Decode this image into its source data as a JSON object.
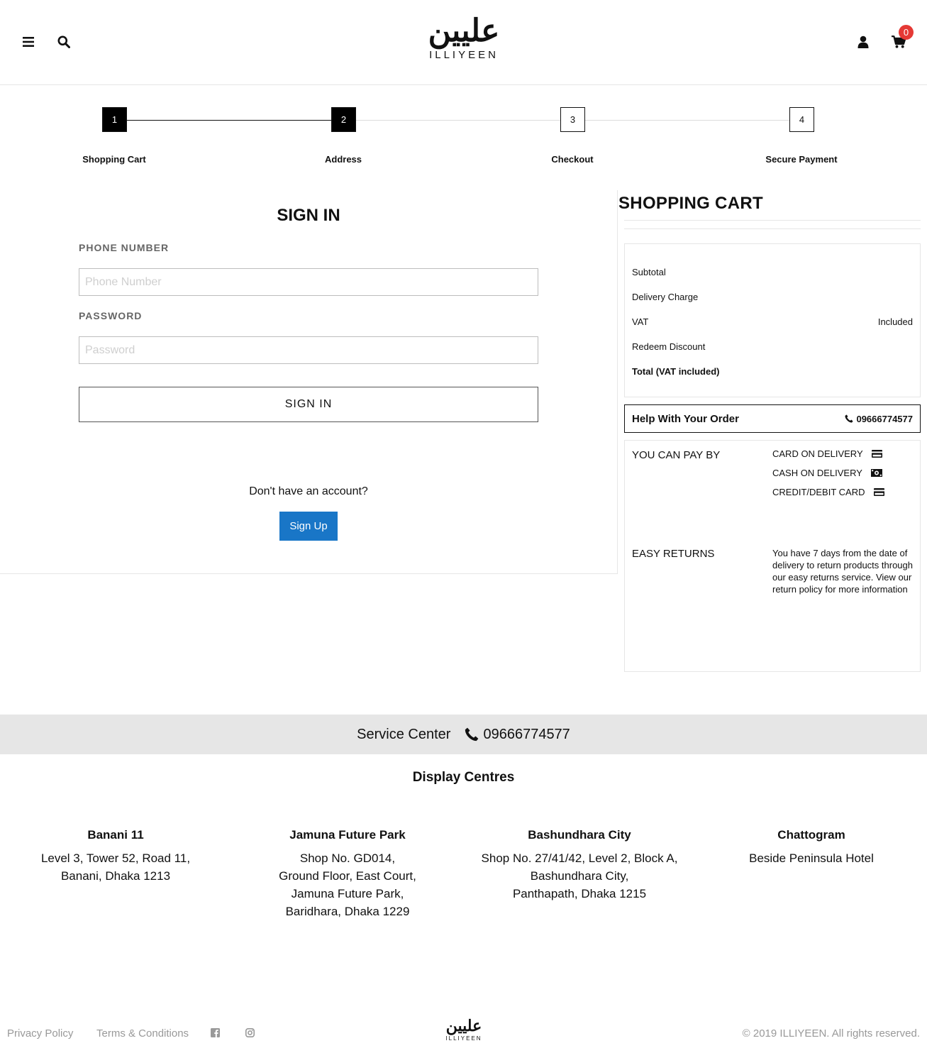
{
  "header": {
    "logo_arabic": "عليين",
    "logo_latin": "ILLIYEEN",
    "cart_count": "0"
  },
  "steps": [
    {
      "number": "1",
      "label": "Shopping Cart"
    },
    {
      "number": "2",
      "label": "Address"
    },
    {
      "number": "3",
      "label": "Checkout"
    },
    {
      "number": "4",
      "label": "Secure Payment"
    }
  ],
  "signin": {
    "title": "SIGN IN",
    "phone_label": "PHONE NUMBER",
    "phone_placeholder": "Phone Number",
    "phone_value": "",
    "password_label": "PASSWORD",
    "password_placeholder": "Password",
    "password_value": "",
    "button_label": "SIGN IN",
    "no_account_text": "Don't have an account?",
    "signup_label": "Sign Up"
  },
  "cart": {
    "title": "SHOPPING CART",
    "rows": [
      {
        "label": "Subtotal",
        "value": ""
      },
      {
        "label": "Delivery Charge",
        "value": ""
      },
      {
        "label": "VAT",
        "value": "Included"
      },
      {
        "label": "Redeem Discount",
        "value": ""
      },
      {
        "label": "Total (VAT included)",
        "value": ""
      }
    ],
    "help_title": "Help With Your Order",
    "help_phone": "09666774577",
    "pay_heading": "YOU CAN PAY BY",
    "pay_methods": [
      {
        "label": "CARD ON DELIVERY",
        "icon": "credit-card-icon"
      },
      {
        "label": "CASH ON DELIVERY",
        "icon": "cash-icon"
      },
      {
        "label": "CREDIT/DEBIT CARD",
        "icon": "credit-card-icon"
      }
    ],
    "returns_heading": "EASY RETURNS",
    "returns_text": "You have 7 days from the date of delivery to return products through our easy returns service. View our return policy for more information"
  },
  "service": {
    "label": "Service Center",
    "phone": "09666774577"
  },
  "display_centres": {
    "title": "Display Centres",
    "centres": [
      {
        "name": "Banani 11",
        "lines": [
          "Level 3, Tower 52, Road 11,",
          "Banani, Dhaka 1213"
        ]
      },
      {
        "name": "Jamuna Future Park",
        "lines": [
          "Shop No. GD014,",
          "Ground Floor, East Court,",
          "Jamuna Future Park,",
          "Baridhara, Dhaka 1229"
        ]
      },
      {
        "name": "Bashundhara City",
        "lines": [
          "Shop No. 27/41/42, Level 2, Block A,",
          "Bashundhara City,",
          "Panthapath, Dhaka 1215"
        ]
      },
      {
        "name": "Chattogram",
        "lines": [
          "Beside Peninsula Hotel"
        ]
      }
    ]
  },
  "footer": {
    "privacy": "Privacy Policy",
    "terms": "Terms & Conditions",
    "logo_arabic": "عليين",
    "logo_latin": "ILLIYEEN",
    "copyright": "© 2019 ILLIYEEN. All rights reserved."
  }
}
